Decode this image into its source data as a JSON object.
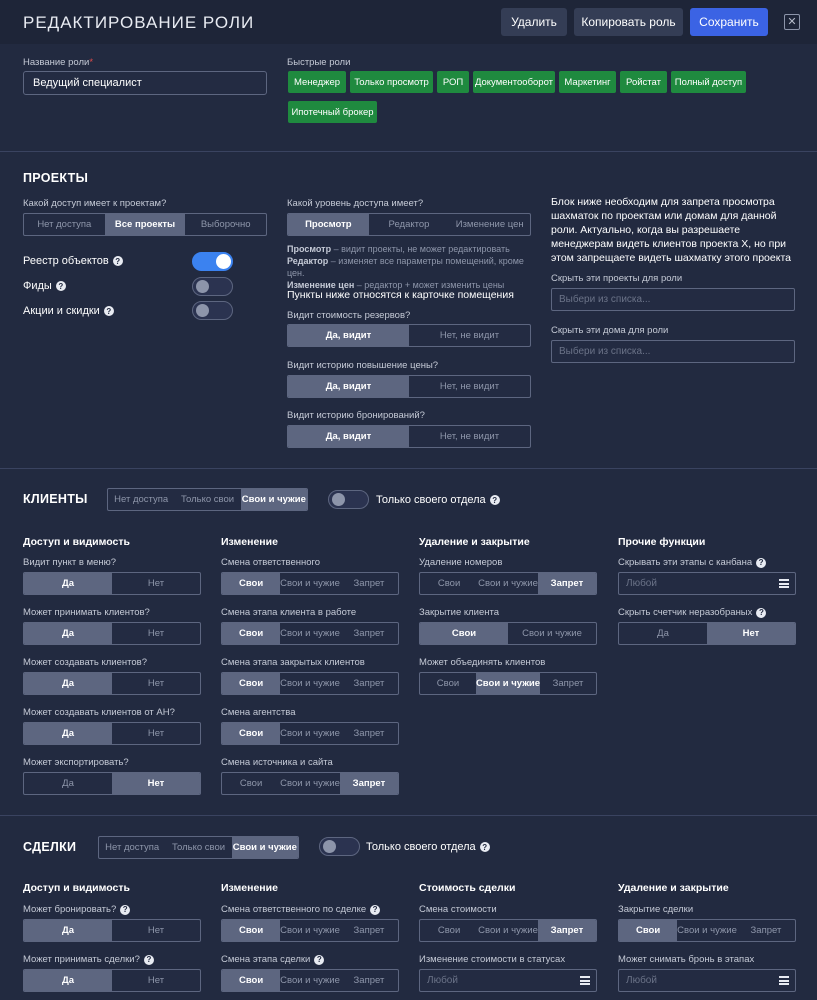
{
  "header": {
    "title": "РЕДАКТИРОВАНИЕ РОЛИ",
    "delete_label": "Удалить",
    "copy_label": "Копировать роль",
    "save_label": "Сохранить",
    "close_glyph": "✕"
  },
  "role": {
    "name_label": "Название роли",
    "required_mark": "*",
    "name_value": "Ведущий специалист",
    "quick_roles_label": "Быстрые роли",
    "quick_roles": [
      "Менеджер",
      "Только просмотр",
      "РОП",
      "Документооборот",
      "Маркетинг",
      "Ройстат",
      "Полный доступ",
      "Ипотечный брокер"
    ]
  },
  "projects": {
    "title": "ПРОЕКТЫ",
    "access_question": "Какой доступ имеет к проектам?",
    "access_options": [
      "Нет доступа",
      "Все проекты",
      "Выборочно"
    ],
    "toggles": [
      {
        "label": "Реестр объектов",
        "on": true
      },
      {
        "label": "Фиды",
        "on": false
      },
      {
        "label": "Акции и скидки",
        "on": false
      }
    ],
    "level_question": "Какой уровень доступа имеет?",
    "level_options": [
      "Просмотр",
      "Редактор",
      "Изменение цен"
    ],
    "level_desc": [
      {
        "term": "Просмотр",
        "text": " – видит проекты, не может редактировать"
      },
      {
        "term": "Редактор",
        "text": " – изменяет все параметры помещений, кроме цен."
      },
      {
        "term": "Изменение цен",
        "text": " – редактор + может изменить цены"
      }
    ],
    "card_heading": "Пункты ниже относятся к карточке помещения",
    "card_items": [
      {
        "question": "Видит стоимость резервов?",
        "yes": "Да, видит",
        "no": "Нет, не видит"
      },
      {
        "question": "Видит историю повышение цены?",
        "yes": "Да, видит",
        "no": "Нет, не видит"
      },
      {
        "question": "Видит историю бронирований?",
        "yes": "Да, видит",
        "no": "Нет, не видит"
      }
    ],
    "info_text": "Блок ниже необходим для запрета просмотра шахматок по проектам или домам для данной роли. Актуально, когда вы разрешаете менеджерам видеть клиентов проекта X, но при этом запрещаете видеть шахматку этого проекта",
    "hide_projects_label": "Скрыть эти проекты для роли",
    "hide_houses_label": "Скрыть эти дома для роли",
    "select_placeholder": "Выбери из списка..."
  },
  "clients": {
    "title": "КЛИЕНТЫ",
    "scope_options": [
      "Нет доступа",
      "Только свои",
      "Свои и чужие"
    ],
    "dept_label": "Только своего отдела",
    "col1": {
      "title": "Доступ и видимость",
      "items": [
        {
          "q": "Видит пункт в меню?",
          "opts": [
            "Да",
            "Нет"
          ],
          "sel": 0
        },
        {
          "q": "Может принимать клиентов?",
          "opts": [
            "Да",
            "Нет"
          ],
          "sel": 0
        },
        {
          "q": "Может создавать клиентов?",
          "opts": [
            "Да",
            "Нет"
          ],
          "sel": 0
        },
        {
          "q": "Может создавать клиентов от АН?",
          "opts": [
            "Да",
            "Нет"
          ],
          "sel": 0
        },
        {
          "q": "Может экспортировать?",
          "opts": [
            "Да",
            "Нет"
          ],
          "sel": 1
        }
      ]
    },
    "col2": {
      "title": "Изменение",
      "items": [
        {
          "q": "Смена ответственного",
          "opts": [
            "Свои",
            "Свои и чужие",
            "Запрет"
          ],
          "sel": 0
        },
        {
          "q": "Смена этапа клиента в работе",
          "opts": [
            "Свои",
            "Свои и чужие",
            "Запрет"
          ],
          "sel": 0
        },
        {
          "q": "Смена этапа закрытых клиентов",
          "opts": [
            "Свои",
            "Свои и чужие",
            "Запрет"
          ],
          "sel": 0
        },
        {
          "q": "Смена агентства",
          "opts": [
            "Свои",
            "Свои и чужие",
            "Запрет"
          ],
          "sel": 0
        },
        {
          "q": "Смена источника и сайта",
          "opts": [
            "Свои",
            "Свои и чужие",
            "Запрет"
          ],
          "sel": 2
        }
      ]
    },
    "col3": {
      "title": "Удаление и закрытие",
      "items": [
        {
          "q": "Удаление номеров",
          "opts": [
            "Свои",
            "Свои и чужие",
            "Запрет"
          ],
          "sel": 2
        },
        {
          "q": "Закрытие клиента",
          "opts": [
            "Свои",
            "Свои и чужие"
          ],
          "sel": 0
        },
        {
          "q": "Может объединять клиентов",
          "opts": [
            "Свои",
            "Свои и чужие",
            "Запрет"
          ],
          "sel": 1
        }
      ]
    },
    "col4": {
      "title": "Прочие функции",
      "kanban_label": "Скрывать эти этапы с канбана",
      "kanban_placeholder": "Любой",
      "counter_label": "Скрыть счетчик неразобраных",
      "counter_opts": [
        "Да",
        "Нет"
      ],
      "counter_sel": 1
    }
  },
  "deals": {
    "title": "СДЕЛКИ",
    "scope_options": [
      "Нет доступа",
      "Только свои",
      "Свои и чужие"
    ],
    "dept_label": "Только своего отдела",
    "col1": {
      "title": "Доступ и видимость",
      "items": [
        {
          "q": "Может бронировать?",
          "opts": [
            "Да",
            "Нет"
          ],
          "sel": 0
        },
        {
          "q": "Может принимать сделки?",
          "opts": [
            "Да",
            "Нет"
          ],
          "sel": 0
        }
      ]
    },
    "col2": {
      "title": "Изменение",
      "items": [
        {
          "q": "Смена ответственного по сделке",
          "opts": [
            "Свои",
            "Свои и чужие",
            "Запрет"
          ],
          "sel": 0
        },
        {
          "q": "Смена этапа сделки",
          "opts": [
            "Свои",
            "Свои и чужие",
            "Запрет"
          ],
          "sel": 0
        }
      ]
    },
    "col3": {
      "title": "Стоимость сделки",
      "cost_label": "Смена стоимости",
      "cost_opts": [
        "Свои",
        "Свои и чужие",
        "Запрет"
      ],
      "cost_sel": 2,
      "status_cost_label": "Изменение стоимости в статусах",
      "status_cost_placeholder": "Любой"
    },
    "col4": {
      "title": "Удаление и закрытие",
      "close_label": "Закрытие сделки",
      "close_opts": [
        "Свои",
        "Свои и чужие",
        "Запрет"
      ],
      "close_sel": 0,
      "unbook_label": "Может снимать бронь в этапах",
      "unbook_placeholder": "Любой"
    }
  }
}
